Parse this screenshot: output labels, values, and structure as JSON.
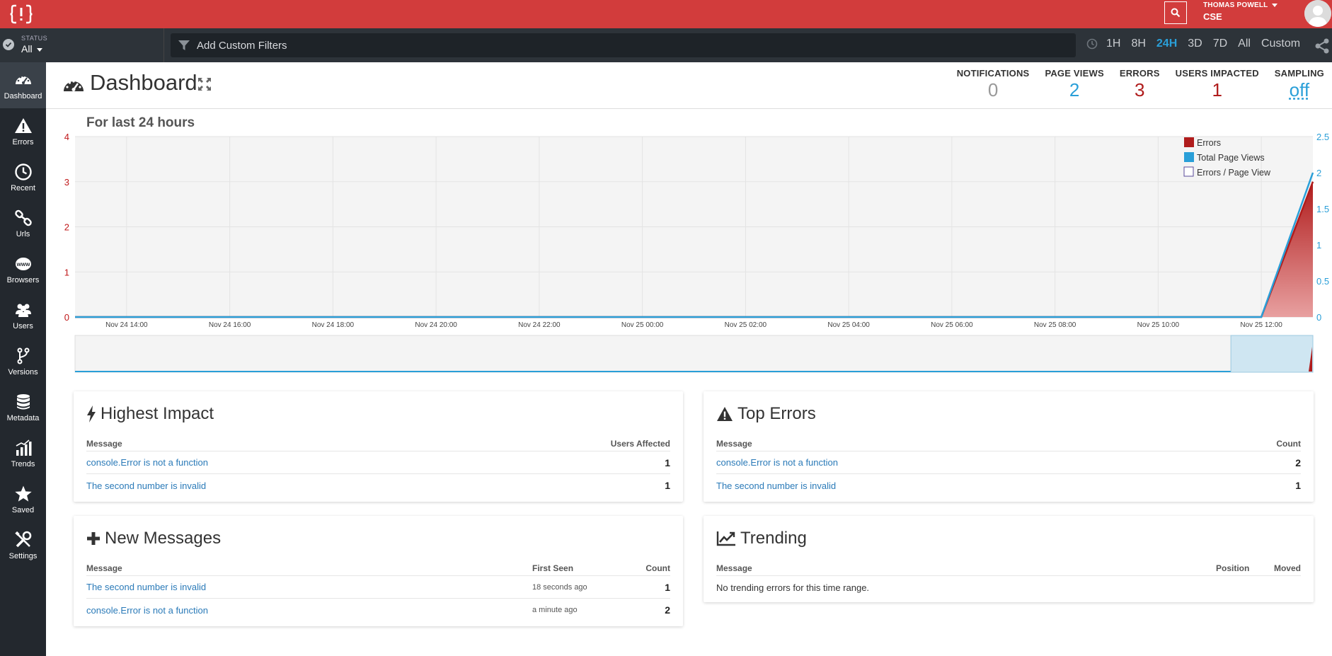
{
  "topbar": {
    "user_name": "THOMAS POWELL",
    "user_org": "CSE"
  },
  "filterbar": {
    "status_label": "STATUS",
    "status_value": "All",
    "filter_placeholder": "Add Custom Filters",
    "time_ranges": [
      "1H",
      "8H",
      "24H",
      "3D",
      "7D",
      "All",
      "Custom"
    ],
    "active_range": "24H"
  },
  "sidebar": {
    "items": [
      {
        "label": "Dashboard",
        "icon": "dashboard-icon"
      },
      {
        "label": "Errors",
        "icon": "warning-icon"
      },
      {
        "label": "Recent",
        "icon": "clock-icon"
      },
      {
        "label": "Urls",
        "icon": "link-icon"
      },
      {
        "label": "Browsers",
        "icon": "www-icon"
      },
      {
        "label": "Users",
        "icon": "users-icon"
      },
      {
        "label": "Versions",
        "icon": "branch-icon"
      },
      {
        "label": "Metadata",
        "icon": "database-icon"
      },
      {
        "label": "Trends",
        "icon": "bar-chart-icon"
      },
      {
        "label": "Saved",
        "icon": "star-icon"
      },
      {
        "label": "Settings",
        "icon": "tools-icon"
      }
    ]
  },
  "header": {
    "title": "Dashboard",
    "stats": [
      {
        "label": "NOTIFICATIONS",
        "value": "0",
        "color": "#999999"
      },
      {
        "label": "PAGE VIEWS",
        "value": "2",
        "color": "#2a9fd8"
      },
      {
        "label": "ERRORS",
        "value": "3",
        "color": "#b01c1c"
      },
      {
        "label": "USERS IMPACTED",
        "value": "1",
        "color": "#b01c1c"
      },
      {
        "label": "SAMPLING",
        "value": "off",
        "color": "#2a9fd8"
      }
    ]
  },
  "chart_data": {
    "type": "area",
    "title": "For last 24 hours",
    "x_ticks": [
      "Nov 24 14:00",
      "Nov 24 16:00",
      "Nov 24 18:00",
      "Nov 24 20:00",
      "Nov 24 22:00",
      "Nov 25 00:00",
      "Nov 25 02:00",
      "Nov 25 04:00",
      "Nov 25 06:00",
      "Nov 25 08:00",
      "Nov 25 10:00",
      "Nov 25 12:00"
    ],
    "y_left_ticks": [
      "0",
      "1",
      "2",
      "3",
      "4"
    ],
    "y_left_range": [
      0,
      4
    ],
    "y_right_ticks": [
      "0",
      "0.5",
      "1",
      "1.5",
      "2",
      "2.5"
    ],
    "y_right_range": [
      0,
      2.5
    ],
    "x_domain": [
      "Nov 24 13:00",
      "Nov 25 13:00"
    ],
    "legend_position": "top-right",
    "grid": true,
    "series": [
      {
        "name": "Errors",
        "color": "#b01c1c",
        "axis": "left",
        "x": [
          "Nov 24 13:00",
          "Nov 25 12:00",
          "Nov 25 13:00"
        ],
        "y": [
          0,
          0,
          3
        ]
      },
      {
        "name": "Total Page Views",
        "color": "#2a9fd8",
        "axis": "right",
        "x": [
          "Nov 24 13:00",
          "Nov 25 12:00",
          "Nov 25 13:00"
        ],
        "y": [
          0,
          0,
          2
        ]
      },
      {
        "name": "Errors / Page View",
        "color": "#ffffff",
        "axis": "left",
        "x": [],
        "y": []
      }
    ]
  },
  "highest_impact": {
    "title": "Highest Impact",
    "columns": [
      "Message",
      "Users Affected"
    ],
    "rows": [
      {
        "message": "console.Error is not a function",
        "count": "1"
      },
      {
        "message": "The second number is invalid",
        "count": "1"
      }
    ]
  },
  "top_errors": {
    "title": "Top Errors",
    "columns": [
      "Message",
      "Count"
    ],
    "rows": [
      {
        "message": "console.Error is not a function",
        "count": "2"
      },
      {
        "message": "The second number is invalid",
        "count": "1"
      }
    ]
  },
  "new_messages": {
    "title": "New Messages",
    "columns": [
      "Message",
      "First Seen",
      "Count"
    ],
    "rows": [
      {
        "message": "The second number is invalid",
        "first_seen": "18 seconds ago",
        "count": "1"
      },
      {
        "message": "console.Error is not a function",
        "first_seen": "a minute ago",
        "count": "2"
      }
    ]
  },
  "trending": {
    "title": "Trending",
    "columns": [
      "Message",
      "Position",
      "Moved"
    ],
    "empty_text": "No trending errors for this time range."
  }
}
